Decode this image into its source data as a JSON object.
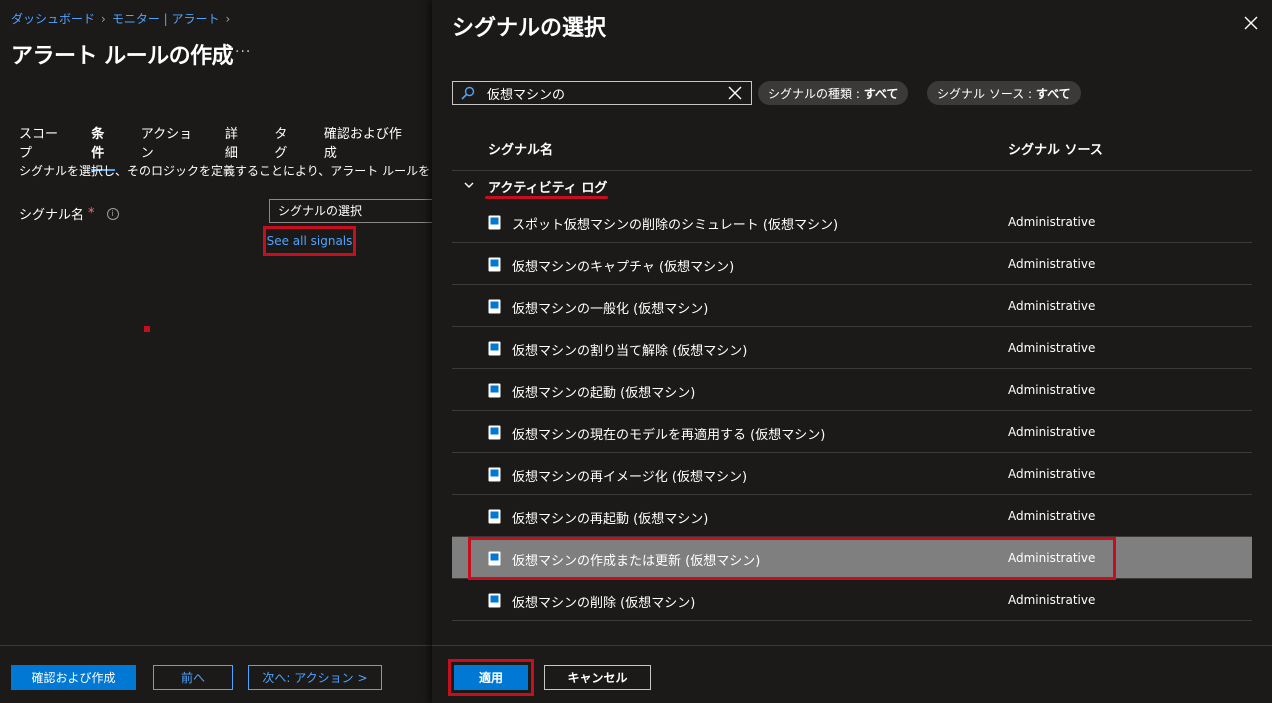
{
  "breadcrumb": {
    "items": [
      "ダッシュボード",
      "モニター | アラート"
    ]
  },
  "page": {
    "title": "アラート ルールの作成",
    "more": "···"
  },
  "tabs": [
    "スコープ",
    "条件",
    "アクション",
    "詳細",
    "タグ",
    "確認および作成"
  ],
  "condition": {
    "description": "シグナルを選択し、そのロジックを定義することにより、アラート ルールをトリガーするタ",
    "signal_label": "シグナル名",
    "required_mark": "*",
    "info": "i",
    "signal_placeholder": "シグナルの選択",
    "see_all": "See all signals"
  },
  "left_footer": {
    "review": "確認および作成",
    "prev": "前へ",
    "next": "次へ: アクション >"
  },
  "panel": {
    "title": "シグナルの選択",
    "search_value": "仮想マシンの",
    "filters": {
      "type_label": "シグナルの種類 :",
      "type_value": "すべて",
      "source_label": "シグナル ソース :",
      "source_value": "すべて"
    },
    "columns": {
      "name": "シグナル名",
      "source": "シグナル ソース"
    },
    "group": "アクティビティ ログ",
    "rows": [
      {
        "name": "スポット仮想マシンの削除のシミュレート (仮想マシン)",
        "source": "Administrative"
      },
      {
        "name": "仮想マシンのキャプチャ (仮想マシン)",
        "source": "Administrative"
      },
      {
        "name": "仮想マシンの一般化 (仮想マシン)",
        "source": "Administrative"
      },
      {
        "name": "仮想マシンの割り当て解除 (仮想マシン)",
        "source": "Administrative"
      },
      {
        "name": "仮想マシンの起動 (仮想マシン)",
        "source": "Administrative"
      },
      {
        "name": "仮想マシンの現在のモデルを再適用する (仮想マシン)",
        "source": "Administrative"
      },
      {
        "name": "仮想マシンの再イメージ化 (仮想マシン)",
        "source": "Administrative"
      },
      {
        "name": "仮想マシンの再起動 (仮想マシン)",
        "source": "Administrative"
      },
      {
        "name": "仮想マシンの作成または更新 (仮想マシン)",
        "source": "Administrative"
      },
      {
        "name": "仮想マシンの削除 (仮想マシン)",
        "source": "Administrative"
      }
    ],
    "apply": "適用",
    "cancel": "キャンセル"
  },
  "colors": {
    "accent": "#0078d4",
    "link": "#4fa3ff",
    "highlight": "#c50f1f",
    "selected_row": "#7f7f7f"
  }
}
